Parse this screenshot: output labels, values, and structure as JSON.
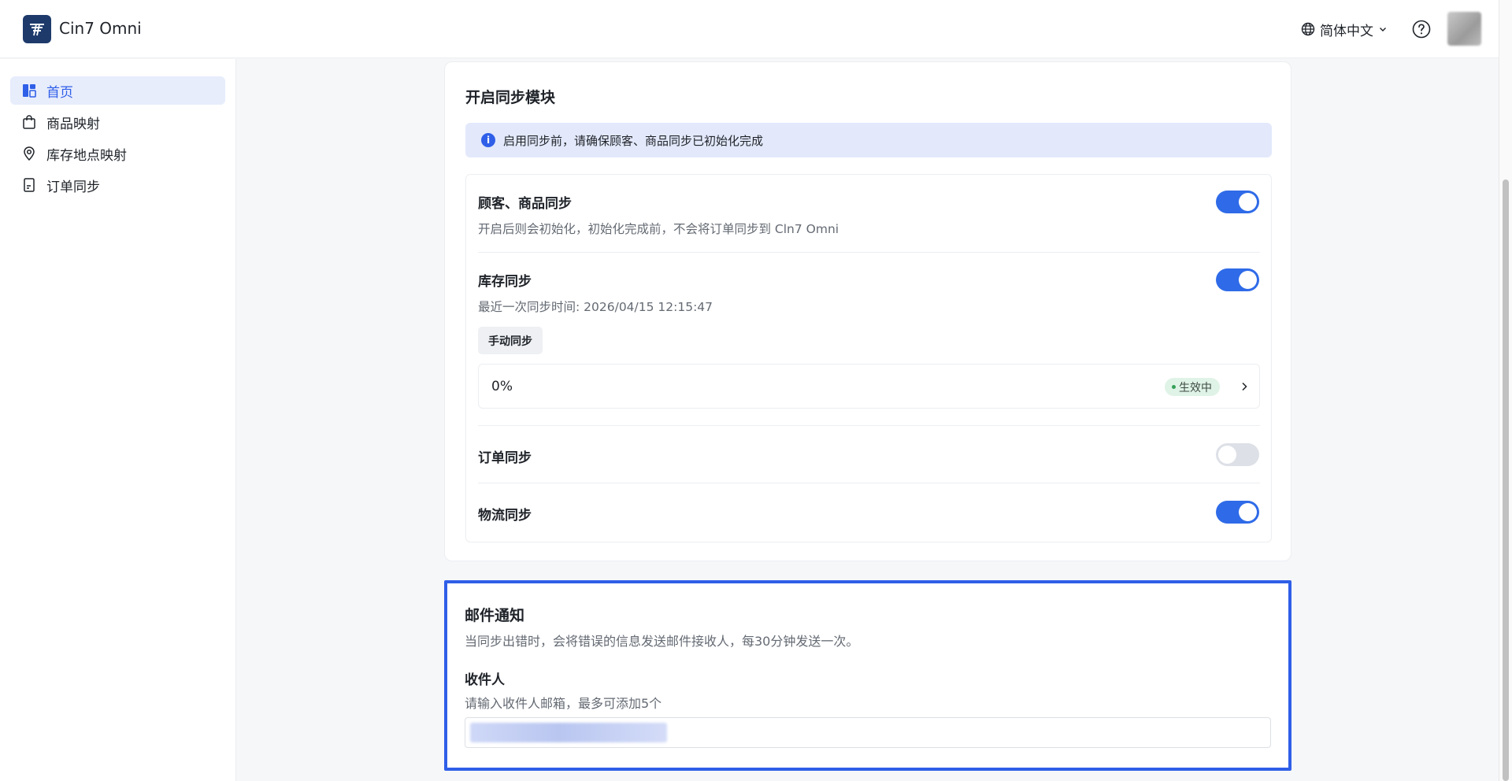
{
  "header": {
    "app_title": "Cin7 Omni",
    "language": "简体中文"
  },
  "sidebar": {
    "items": [
      {
        "label": "首页",
        "icon": "dashboard-icon",
        "active": true
      },
      {
        "label": "商品映射",
        "icon": "shopping-bag-icon",
        "active": false
      },
      {
        "label": "库存地点映射",
        "icon": "location-pin-icon",
        "active": false
      },
      {
        "label": "订单同步",
        "icon": "document-icon",
        "active": false
      }
    ]
  },
  "sync_card": {
    "title": "开启同步模块",
    "alert": "启用同步前，请确保顾客、商品同步已初始化完成",
    "rows": {
      "customer_product": {
        "title": "顾客、商品同步",
        "desc": "开启后则会初始化，初始化完成前，不会将订单同步到 Cln7 Omni",
        "enabled": true
      },
      "inventory": {
        "title": "库存同步",
        "desc": "最近一次同步时间: 2026/04/15 12:15:47",
        "enabled": true,
        "manual_button": "手动同步",
        "progress": "0%",
        "status": "生效中"
      },
      "order": {
        "title": "订单同步",
        "enabled": false
      },
      "logistics": {
        "title": "物流同步",
        "enabled": true
      }
    }
  },
  "email_card": {
    "title": "邮件通知",
    "desc": "当同步出错时，会将错误的信息发送邮件接收人，每30分钟发送一次。",
    "recipient_label": "收件人",
    "recipient_hint": "请输入收件人邮箱，最多可添加5个"
  },
  "colors": {
    "accent": "#2f5fe8",
    "toggle_on": "#2f6be8",
    "toggle_off": "#dde0e6",
    "badge_bg": "#dff3e6"
  }
}
